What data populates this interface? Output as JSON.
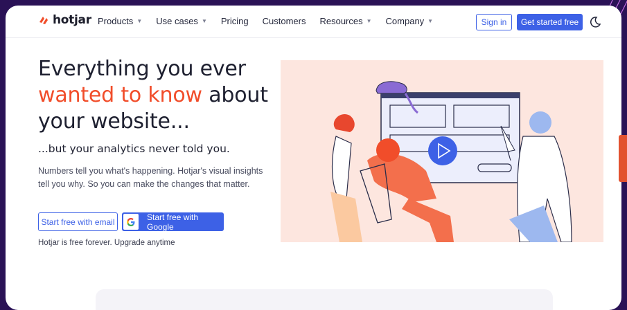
{
  "brand": {
    "name": "hotjar",
    "accent": "#f14d2a",
    "primary": "#3d61e6"
  },
  "nav": {
    "items": [
      {
        "label": "Products",
        "dropdown": true
      },
      {
        "label": "Use cases",
        "dropdown": true
      },
      {
        "label": "Pricing",
        "dropdown": false
      },
      {
        "label": "Customers",
        "dropdown": false
      },
      {
        "label": "Resources",
        "dropdown": true
      },
      {
        "label": "Company",
        "dropdown": true
      }
    ],
    "sign_in": "Sign in",
    "get_started": "Get started free",
    "theme_icon": "moon-icon"
  },
  "hero": {
    "title_part1": "Everything you ever",
    "title_accent": "wanted to know",
    "title_part2": "about",
    "title_part3": "your website...",
    "subtitle": "...but your analytics never told you.",
    "description": "Numbers tell you what's happening. Hotjar's visual insights tell you why. So you can make the changes that matter.",
    "cta_email": "Start free with email",
    "cta_google": "Start free with Google",
    "note": "Hotjar is free forever. Upgrade anytime"
  }
}
